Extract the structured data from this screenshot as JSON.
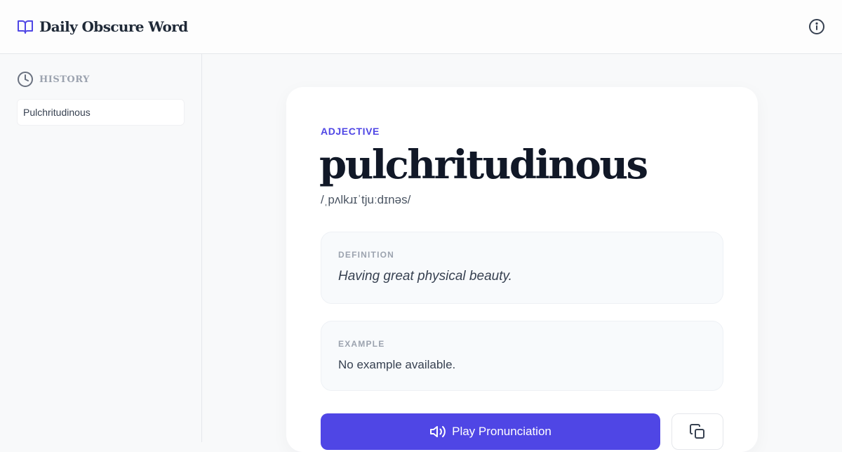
{
  "header": {
    "title": "Daily Obscure Word",
    "brand_icon": "book-open-icon",
    "info_icon": "info-icon"
  },
  "sidebar": {
    "title": "HISTORY",
    "title_icon": "clock-icon",
    "items": [
      {
        "label": "Pulchritudinous"
      }
    ]
  },
  "word_card": {
    "part_of_speech": "ADJECTIVE",
    "word": "pulchritudinous",
    "phonetic": "/ˌpʌlkɹɪˈtjuːdɪnəs/",
    "definition_label": "DEFINITION",
    "definition": "Having great physical beauty.",
    "example_label": "EXAMPLE",
    "example": "No example available.",
    "play_button_label": "Play Pronunciation",
    "play_icon": "speaker-icon",
    "copy_icon": "copy-icon"
  },
  "colors": {
    "accent": "#4f46e5",
    "text_dark": "#111827",
    "muted": "#9ca3af"
  }
}
